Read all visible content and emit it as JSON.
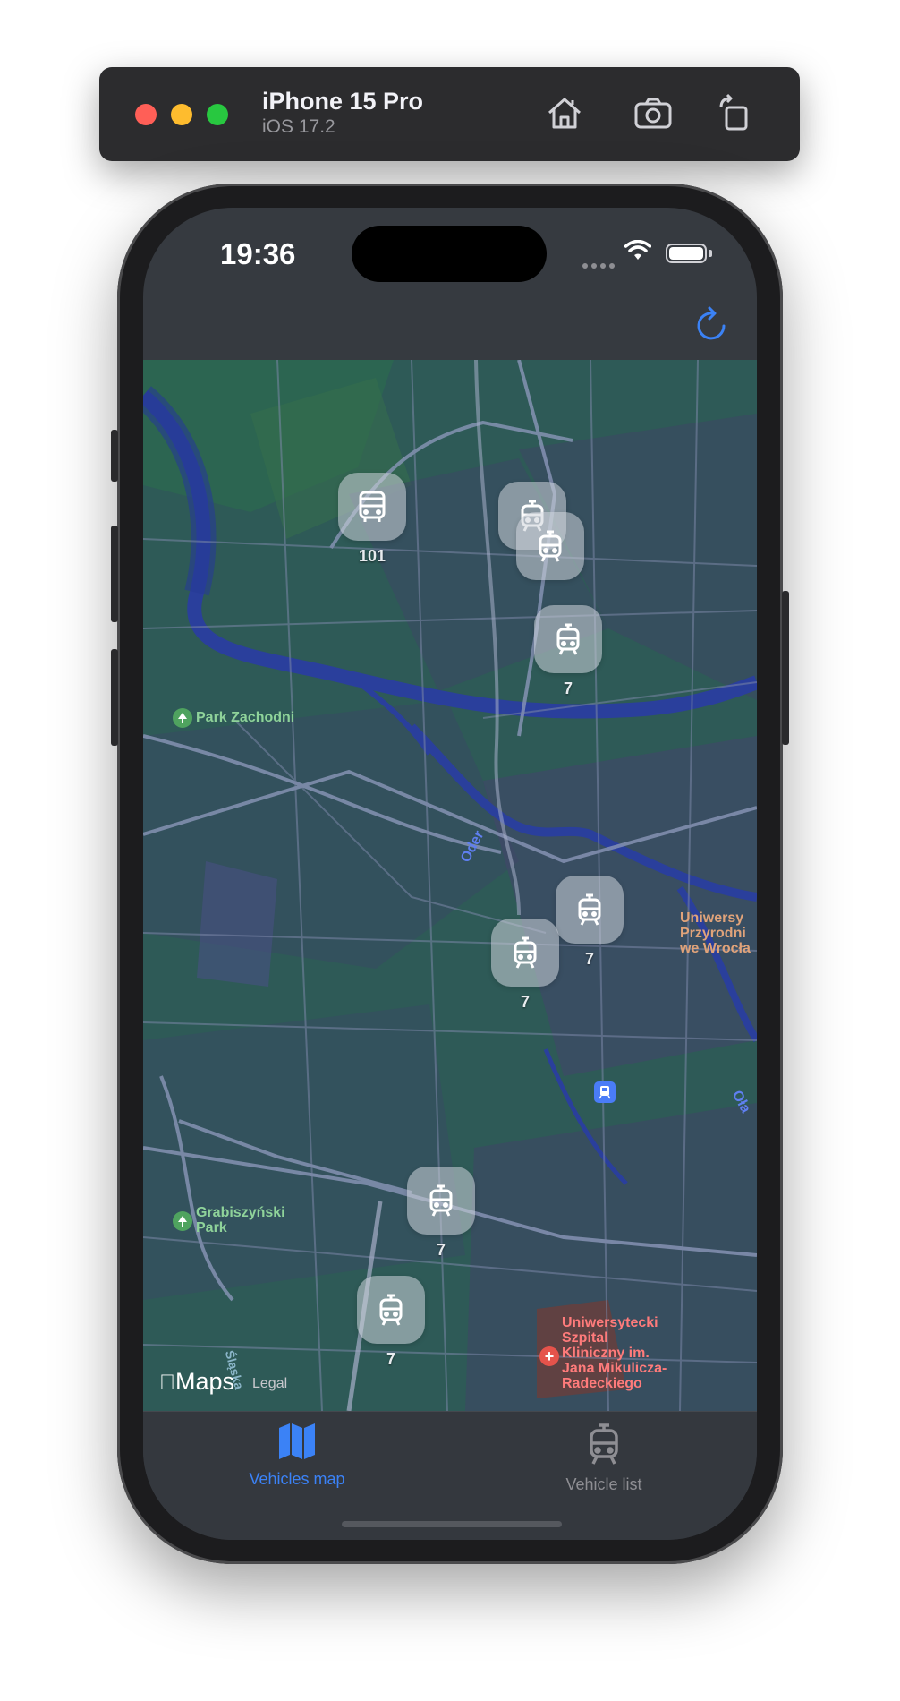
{
  "simulator": {
    "device_name": "iPhone 15 Pro",
    "os_version": "iOS 17.2",
    "buttons": [
      "home-icon",
      "screenshot-icon",
      "rotate-icon"
    ]
  },
  "status_bar": {
    "time": "19:36"
  },
  "nav": {
    "refresh_icon": "refresh-icon",
    "accent_color": "#3b82f6"
  },
  "map": {
    "vehicles": [
      {
        "type": "bus",
        "line": "101"
      },
      {
        "type": "tram",
        "line": ""
      },
      {
        "type": "tram",
        "line": ""
      },
      {
        "type": "tram",
        "line": "7"
      },
      {
        "type": "tram",
        "line": "7"
      },
      {
        "type": "tram",
        "line": "7"
      },
      {
        "type": "tram",
        "line": "7"
      },
      {
        "type": "tram",
        "line": "7"
      }
    ],
    "places": {
      "park_zachodni": "Park Zachodni",
      "grabiszynski_park": "Grabiszyński\nPark",
      "university": "Uniwersy\nPrzyrodni\nwe Wrocła",
      "hospital": "Uniwersytecki\nSzpital\nKliniczny im.\nJana Mikulicza-\nRadeckiego",
      "river_oder": "Oder",
      "river_olawa": "Oła",
      "street_slezna": "Śląska"
    },
    "attribution": {
      "maps": "Maps",
      "legal": "Legal"
    }
  },
  "tabs": [
    {
      "label": "Vehicles map",
      "icon": "map-icon",
      "selected": true
    },
    {
      "label": "Vehicle list",
      "icon": "tram-icon",
      "selected": false
    }
  ]
}
